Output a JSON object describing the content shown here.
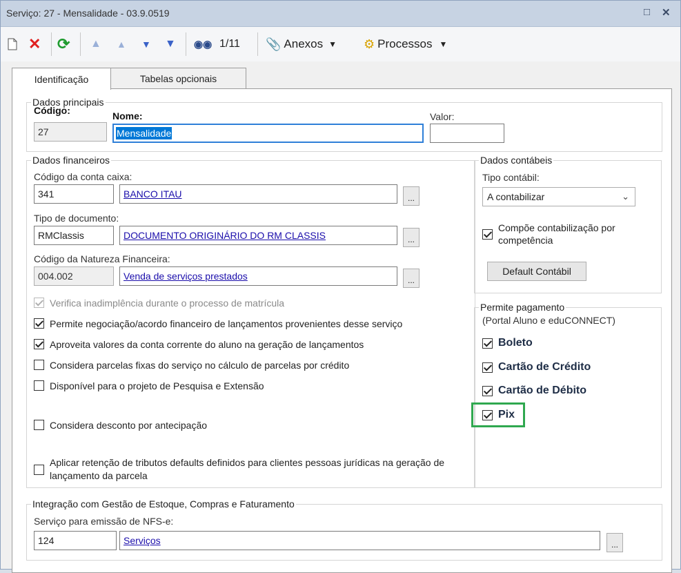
{
  "window": {
    "title": "Serviço: 27 - Mensalidade - 03.9.0519"
  },
  "toolbar": {
    "record_counter": "1/11",
    "attachments_label": "Anexos",
    "processes_label": "Processos"
  },
  "tabs": [
    {
      "label": "Identificação",
      "active": true
    },
    {
      "label": "Tabelas opcionais",
      "active": false
    }
  ],
  "dados_principais": {
    "legend": "Dados principais",
    "codigo_label": "Código:",
    "codigo_value": "27",
    "nome_label": "Nome:",
    "nome_value": "Mensalidade",
    "valor_label": "Valor:",
    "valor_value": ""
  },
  "dados_financeiros": {
    "legend": "Dados financeiros",
    "conta_caixa_label": "Código da conta caixa:",
    "conta_caixa_code": "341",
    "conta_caixa_name": "BANCO ITAU",
    "tipo_doc_label": "Tipo de documento:",
    "tipo_doc_code": "RMClassis",
    "tipo_doc_name": "DOCUMENTO ORIGINÁRIO DO RM CLASSIS",
    "natureza_label": "Código da Natureza Financeira:",
    "natureza_code": "004.002",
    "natureza_name": "Venda de serviços prestados",
    "lookup_label": "...",
    "checkboxes": [
      {
        "label": "Verifica inadimplência durante o processo de matrícula",
        "checked": true,
        "disabled": true
      },
      {
        "label": "Permite negociação/acordo financeiro de lançamentos provenientes desse serviço",
        "checked": true,
        "disabled": false
      },
      {
        "label": "Aproveita valores da conta corrente do aluno na geração de lançamentos",
        "checked": true,
        "disabled": false
      },
      {
        "label": "Considera parcelas fixas do serviço no cálculo de parcelas por crédito",
        "checked": false,
        "disabled": false
      },
      {
        "label": "Disponível para o projeto de Pesquisa e Extensão",
        "checked": false,
        "disabled": false
      },
      {
        "label": "Considera desconto por antecipação",
        "checked": false,
        "disabled": false
      },
      {
        "label": "Aplicar retenção de tributos defaults definidos para clientes pessoas jurídicas na geração de lançamento da parcela",
        "checked": false,
        "disabled": false
      }
    ]
  },
  "dados_contabeis": {
    "legend": "Dados contábeis",
    "tipo_label": "Tipo contábil:",
    "tipo_value": "A contabilizar",
    "compoe_label": "Compõe contabilização por competência",
    "compoe_checked": true,
    "default_button": "Default Contábil"
  },
  "pagamento": {
    "legend": "Permite pagamento",
    "subtitle": "(Portal Aluno e eduCONNECT)",
    "options": [
      {
        "label": "Boleto",
        "checked": true
      },
      {
        "label": "Cartão de Crédito",
        "checked": true
      },
      {
        "label": "Cartão de Débito",
        "checked": true
      },
      {
        "label": "Pix",
        "checked": true
      }
    ],
    "highlight_color": "#2fa84f"
  },
  "integracao": {
    "legend": "Integração com Gestão de Estoque, Compras e Faturamento",
    "nfse_label": "Serviço para emissão de NFS-e:",
    "nfse_code": "124",
    "nfse_name": "Serviços"
  }
}
